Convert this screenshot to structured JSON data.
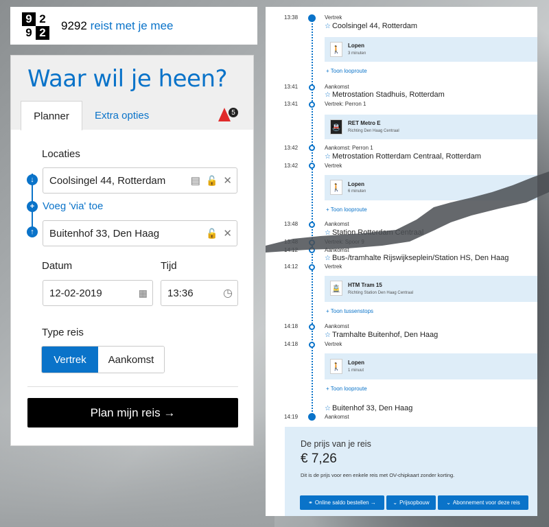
{
  "brand": {
    "logo_digits": [
      "9",
      "2",
      "9",
      "2"
    ],
    "name": "9292",
    "tagline": "reist met je mee"
  },
  "planner": {
    "heading": "Waar wil je heen?",
    "tabs": {
      "planner": "Planner",
      "extra": "Extra opties"
    },
    "alert_count": "5",
    "locations_label": "Locaties",
    "from_value": "Coolsingel 44, Rotterdam",
    "via_label": "Voeg 'via' toe",
    "to_value": "Buitenhof 33, Den Haag",
    "date_label": "Datum",
    "date_value": "12-02-2019",
    "time_label": "Tijd",
    "time_value": "13:36",
    "type_label": "Type reis",
    "type_depart": "Vertrek",
    "type_arrive": "Aankomst",
    "plan_button": "Plan mijn reis →"
  },
  "itinerary": {
    "steps": [
      {
        "time": "13:38",
        "sub": "Vertrek",
        "place": "Coolsingel 44, Rotterdam"
      },
      {
        "leg": "Lopen",
        "detail": "3 minuten",
        "link": "+ Toon looproute"
      },
      {
        "time": "13:41",
        "sub": "Aankomst",
        "place": "Metrostation Stadhuis, Rotterdam"
      },
      {
        "time": "13:41",
        "sub": "Vertrek: Perron 1"
      },
      {
        "leg": "RET Metro E",
        "detail": "Richting Den Haag Centraal"
      },
      {
        "time": "13:42",
        "sub": "Aankomst: Perron 1",
        "place": "Metrostation Rotterdam Centraal, Rotterdam"
      },
      {
        "time": "13:42",
        "sub": "Vertrek"
      },
      {
        "leg": "Lopen",
        "detail": "6 minuten",
        "link": "+ Toon looproute"
      },
      {
        "time": "13:48",
        "sub": "Aankomst",
        "place": "Station Rotterdam Centraal"
      },
      {
        "time": "13:48",
        "sub": "Vertrek: Spoor 9"
      },
      {
        "time": "14:12",
        "sub": "Aankomst",
        "place": "Bus-/tramhalte Rijswijkseplein/Station HS, Den Haag"
      },
      {
        "time": "14:12",
        "sub": "Vertrek"
      },
      {
        "leg": "HTM Tram 15",
        "detail": "Richting Station Den Haag Centraal",
        "link": "+ Toon tussenstops"
      },
      {
        "time": "14:18",
        "sub": "Aankomst",
        "place": "Tramhalte Buitenhof, Den Haag"
      },
      {
        "time": "14:18",
        "sub": "Vertrek"
      },
      {
        "leg": "Lopen",
        "detail": "1 minuut",
        "link": "+ Toon looproute"
      },
      {
        "time": "14:19",
        "sub": "Aankomst",
        "place": "Buitenhof 33, Den Haag"
      }
    ]
  },
  "price": {
    "title": "De prijs van je reis",
    "amount": "€ 7,26",
    "note": "Dit is de prijs voor een enkele reis met OV-chipkaart zonder korting.",
    "btn_online": "Online saldo bestellen →",
    "btn_build": "Prijsopbouw",
    "btn_sub": "Abonnement voor deze reis"
  },
  "colors": {
    "accent": "#0a73c9",
    "leg_bg": "#deedf8",
    "alert": "#e02b2b"
  }
}
